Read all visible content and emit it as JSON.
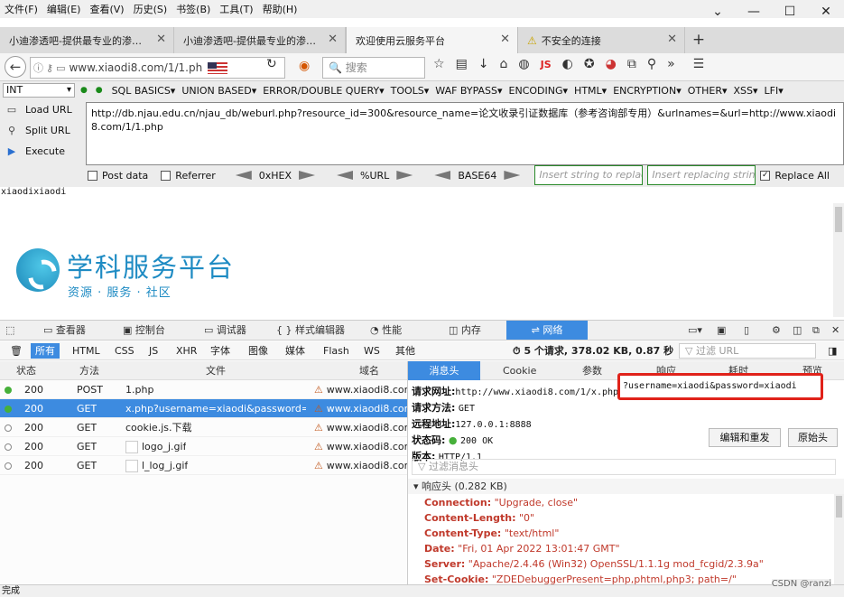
{
  "menu": [
    "文件(F)",
    "编辑(E)",
    "查看(V)",
    "历史(S)",
    "书签(B)",
    "工具(T)",
    "帮助(H)"
  ],
  "window_buttons": [
    "⌄",
    "—",
    "☐",
    "✕"
  ],
  "tabs": [
    "小迪渗透吧-提供最专业的渗…",
    "小迪渗透吧-提供最专业的渗…",
    "欢迎使用云服务平台",
    "不安全的连接"
  ],
  "nav": {
    "url": "www.xiaodi8.com/1/1.ph",
    "search_placeholder": "搜索"
  },
  "hackbar": {
    "type": "INT",
    "menus": [
      "SQL BASICS▾",
      "UNION BASED▾",
      "ERROR/DOUBLE QUERY▾",
      "TOOLS▾",
      "WAF BYPASS▾",
      "ENCODING▾",
      "HTML▾",
      "ENCRYPTION▾",
      "OTHER▾",
      "XSS▾",
      "LFI▾"
    ],
    "load_url": "Load URL",
    "split_url": "Split URL",
    "execute": "Execute",
    "url_text": "http://db.njau.edu.cn/njau_db/weburl.php?resource_id=300&resource_name=论文收录引证数据库（参考咨询部专用）&urlnames=&url=http://www.xiaodi8.com/1/1.php",
    "post_data": "Post data",
    "referrer": "Referrer",
    "hex": "0xHEX",
    "urlenc": "%URL",
    "base64": "BASE64",
    "insert_placeholder": "Insert string to replace",
    "replacing_placeholder": "Insert replacing string",
    "replace_all": "Replace All"
  },
  "page": {
    "text": "xiaodixiaodi",
    "logo_title": "学科服务平台",
    "logo_sub": "资源 · 服务 · 社区"
  },
  "devtools": {
    "tabs": [
      "查看器",
      "控制台",
      "调试器",
      "{ } 样式编辑器",
      "性能",
      "内存",
      "网络"
    ],
    "filters": [
      "所有",
      "HTML",
      "CSS",
      "JS",
      "XHR",
      "字体",
      "图像",
      "媒体",
      "Flash",
      "WS",
      "其他"
    ],
    "summary": "5 个请求, 378.02 KB, 0.87 秒",
    "filter_url": "过滤 URL",
    "columns": [
      "状态",
      "方法",
      "文件",
      "域名"
    ],
    "rows": [
      {
        "status": "200",
        "method": "POST",
        "file": "1.php",
        "domain": "www.xiaodi8.com"
      },
      {
        "status": "200",
        "method": "GET",
        "file": "x.php?username=xiaodi&password=...",
        "domain": "www.xiaodi8.com"
      },
      {
        "status": "200",
        "method": "GET",
        "file": "cookie.js.下载",
        "domain": "www.xiaodi8.com"
      },
      {
        "status": "200",
        "method": "GET",
        "file": "logo_j.gif",
        "domain": "www.xiaodi8.com"
      },
      {
        "status": "200",
        "method": "GET",
        "file": "l_log_j.gif",
        "domain": "www.xiaodi8.com"
      }
    ],
    "detail_tabs": [
      "消息头",
      "Cookie",
      "参数",
      "响应",
      "耗时",
      "预览"
    ],
    "req_url_label": "请求网址:",
    "req_url": "http://www.xiaodi8.com/1/x.php",
    "req_query": "?username=xiaodi&password=xiaodi",
    "method_label": "请求方法:",
    "method": "GET",
    "remote_label": "远程地址:",
    "remote": "127.0.0.1:8888",
    "status_label": "状态码:",
    "status": "200 OK",
    "version_label": "版本:",
    "version": "HTTP/1.1",
    "edit_resend": "编辑和重发",
    "raw_headers": "原始头",
    "filter_headers": "过滤消息头",
    "response_headers": "▾ 响应头 (0.282 KB)",
    "headers": [
      {
        "k": "Connection:",
        "v": "\"Upgrade, close\""
      },
      {
        "k": "Content-Length:",
        "v": "\"0\""
      },
      {
        "k": "Content-Type:",
        "v": "\"text/html\""
      },
      {
        "k": "Date:",
        "v": "\"Fri, 01 Apr 2022 13:01:47 GMT\""
      },
      {
        "k": "Server:",
        "v": "\"Apache/2.4.46 (Win32) OpenSSL/1.1.1g mod_fcgid/2.3.9a\""
      },
      {
        "k": "Set-Cookie:",
        "v": "\"ZDEDebuggerPresent=php,phtml,php3; path=/\""
      }
    ]
  },
  "status_text": "完成",
  "watermark": "CSDN @ranzi"
}
